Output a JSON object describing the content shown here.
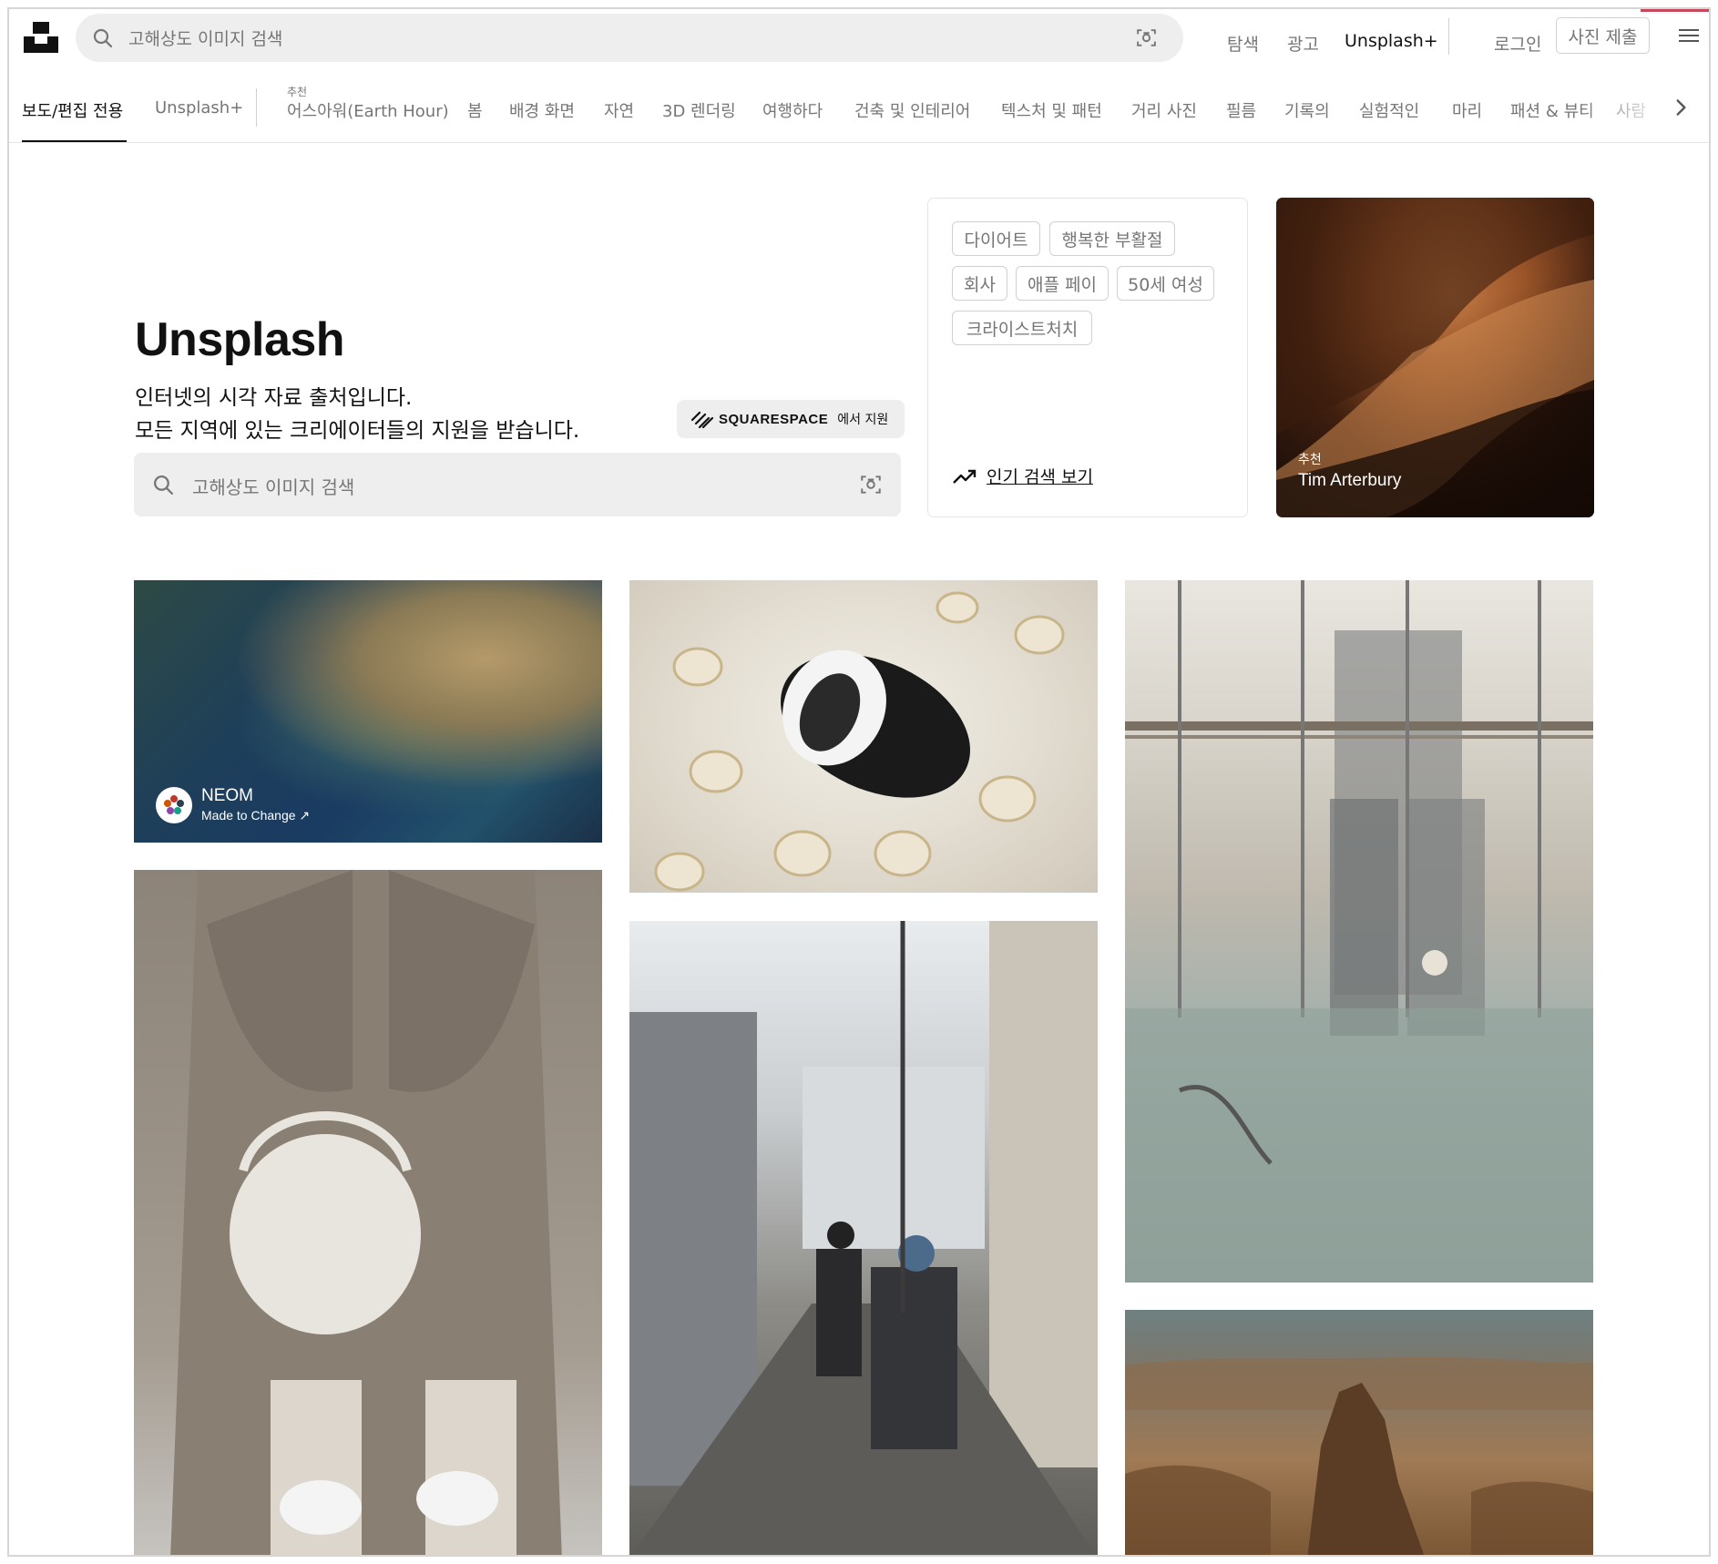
{
  "header": {
    "search_placeholder": "고해상도 이미지 검색",
    "nav": {
      "explore": "탐색",
      "ads": "광고",
      "unsplash_plus": "Unsplash+",
      "login": "로그인",
      "submit": "사진 제출"
    }
  },
  "categories": {
    "featured_label": "추천",
    "items": [
      "보도/편집 전용",
      "Unsplash+",
      "어스아워(Earth Hour)",
      "봄",
      "배경 화면",
      "자연",
      "3D 렌더링",
      "여행하다",
      "건축 및 인테리어",
      "텍스처 및 패턴",
      "거리 사진",
      "필름",
      "기록의",
      "실험적인",
      "마리",
      "패션 & 뷰티",
      "사람"
    ]
  },
  "hero": {
    "title": "Unsplash",
    "line1": "인터넷의 시각 자료 출처입니다.",
    "line2": "모든 지역에 있는 크리에이터들의 지원을 받습니다.",
    "sponsor_name": "SQUARESPACE",
    "sponsor_suffix": "에서 지원",
    "search_placeholder": "고해상도 이미지 검색"
  },
  "trending": {
    "chips": [
      "다이어트",
      "행복한 부활절",
      "회사",
      "애플 페이",
      "50세 여성",
      "크라이스트처치"
    ],
    "link_label": "인기 검색 보기"
  },
  "featured": {
    "label": "추천",
    "author": "Tim Arterbury"
  },
  "sponsored_photo": {
    "brand": "NEOM",
    "tagline": "Made to Change ↗"
  },
  "colors": {
    "accent": "#c8475a",
    "chip_border": "#d1d1d1",
    "muted_text": "#767676",
    "search_bg": "#eeeeee"
  }
}
